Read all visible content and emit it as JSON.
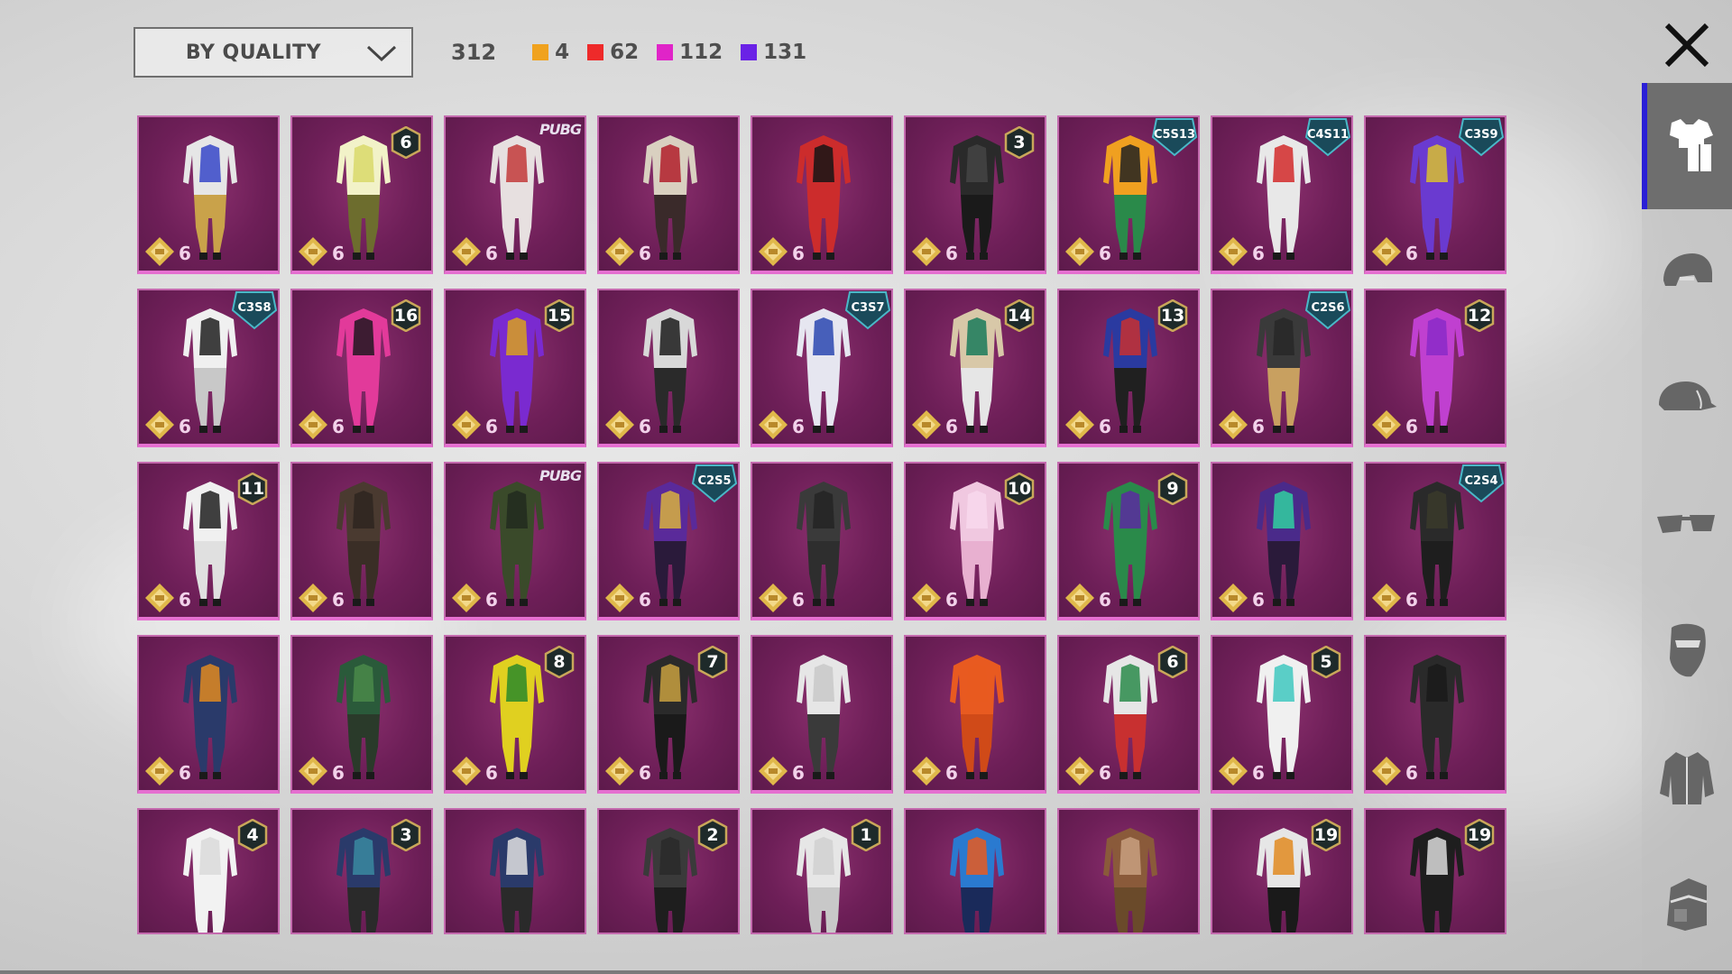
{
  "header": {
    "sort_label": "BY QUALITY",
    "total": "312",
    "quality_counts": [
      {
        "color": "#f0a21e",
        "count": "4"
      },
      {
        "color": "#ee2a2a",
        "count": "62"
      },
      {
        "color": "#e024c8",
        "count": "112"
      },
      {
        "color": "#6a22e6",
        "count": "131"
      }
    ]
  },
  "sidebar": {
    "items": [
      {
        "icon": "outfit-icon",
        "active": true
      },
      {
        "icon": "helmet-icon",
        "active": false
      },
      {
        "icon": "cap-icon",
        "active": false
      },
      {
        "icon": "glasses-icon",
        "active": false
      },
      {
        "icon": "mask-icon",
        "active": false
      },
      {
        "icon": "jacket-icon",
        "active": false
      },
      {
        "icon": "backpack-icon",
        "active": false
      }
    ]
  },
  "items": [
    {
      "qty": "6",
      "badge": "",
      "badge_type": "",
      "colors": [
        "#e6e6e6",
        "#3646c8",
        "#c9a24a"
      ]
    },
    {
      "qty": "6",
      "badge": "6",
      "badge_type": "num",
      "colors": [
        "#f2f2c8",
        "#d9d96a",
        "#6d6d2e"
      ]
    },
    {
      "qty": "6",
      "badge": "PUBG",
      "badge_type": "logo",
      "colors": [
        "#e7e0e0",
        "#c23a3a",
        "#e7e0e0"
      ]
    },
    {
      "qty": "6",
      "badge": "",
      "badge_type": "",
      "colors": [
        "#d9d0c0",
        "#b01e2a",
        "#3a2a2a"
      ]
    },
    {
      "qty": "6",
      "badge": "",
      "badge_type": "",
      "colors": [
        "#cc2c2c",
        "#151515",
        "#cc2c2c"
      ]
    },
    {
      "qty": "6",
      "badge": "3",
      "badge_type": "num",
      "colors": [
        "#2a2a2a",
        "#444444",
        "#1a1a1a"
      ]
    },
    {
      "qty": "6",
      "badge": "C5S13",
      "badge_type": "season",
      "colors": [
        "#f0a020",
        "#222222",
        "#2a8a4a"
      ]
    },
    {
      "qty": "6",
      "badge": "C4S11",
      "badge_type": "season",
      "colors": [
        "#e8e8e8",
        "#d22a2a",
        "#e8e8e8"
      ]
    },
    {
      "qty": "6",
      "badge": "C3S9",
      "badge_type": "season",
      "colors": [
        "#6a3ad0",
        "#d8c030",
        "#6a3ad0"
      ]
    },
    {
      "qty": "6",
      "badge": "C3S8",
      "badge_type": "season",
      "colors": [
        "#f0f0f0",
        "#202020",
        "#c8c8c8"
      ]
    },
    {
      "qty": "6",
      "badge": "16",
      "badge_type": "num",
      "colors": [
        "#e23a9a",
        "#201820",
        "#e23a9a"
      ]
    },
    {
      "qty": "6",
      "badge": "15",
      "badge_type": "num",
      "colors": [
        "#7a2ad0",
        "#d8a020",
        "#7a2ad0"
      ]
    },
    {
      "qty": "6",
      "badge": "",
      "badge_type": "",
      "colors": [
        "#d8d8d8",
        "#1c1c1c",
        "#2a2a2a"
      ]
    },
    {
      "qty": "6",
      "badge": "C3S7",
      "badge_type": "season",
      "colors": [
        "#e6e6f0",
        "#2a46b0",
        "#e6e6f0"
      ]
    },
    {
      "qty": "6",
      "badge": "14",
      "badge_type": "num",
      "colors": [
        "#d8c8a8",
        "#1a7a5a",
        "#e6e6e6"
      ]
    },
    {
      "qty": "6",
      "badge": "13",
      "badge_type": "num",
      "colors": [
        "#2a3aa0",
        "#c83030",
        "#202020"
      ]
    },
    {
      "qty": "6",
      "badge": "C2S6",
      "badge_type": "season",
      "colors": [
        "#3a3a3a",
        "#282828",
        "#c8a060"
      ]
    },
    {
      "qty": "6",
      "badge": "12",
      "badge_type": "num",
      "colors": [
        "#c040d0",
        "#8a2ac8",
        "#c040d0"
      ]
    },
    {
      "qty": "6",
      "badge": "11",
      "badge_type": "num",
      "colors": [
        "#f0f0f0",
        "#202020",
        "#e0e0e0"
      ]
    },
    {
      "qty": "6",
      "badge": "",
      "badge_type": "",
      "colors": [
        "#4a3a30",
        "#2e2620",
        "#3a2e26"
      ]
    },
    {
      "qty": "6",
      "badge": "PUBG",
      "badge_type": "logo",
      "colors": [
        "#3a4a2a",
        "#222a1e",
        "#3a4a2a"
      ]
    },
    {
      "qty": "6",
      "badge": "C2S5",
      "badge_type": "season",
      "colors": [
        "#5a2a9a",
        "#d8b040",
        "#2a1a3a"
      ]
    },
    {
      "qty": "6",
      "badge": "",
      "badge_type": "",
      "colors": [
        "#3a3a3a",
        "#242424",
        "#2e2e2e"
      ]
    },
    {
      "qty": "6",
      "badge": "10",
      "badge_type": "num",
      "colors": [
        "#f0c8e0",
        "#f8d8ec",
        "#e8b0d0"
      ]
    },
    {
      "qty": "6",
      "badge": "9",
      "badge_type": "num",
      "colors": [
        "#2a8a4a",
        "#5a2aa0",
        "#2a8a4a"
      ]
    },
    {
      "qty": "6",
      "badge": "",
      "badge_type": "",
      "colors": [
        "#4a2a8a",
        "#30d0a0",
        "#2a1a3a"
      ]
    },
    {
      "qty": "6",
      "badge": "C2S4",
      "badge_type": "season",
      "colors": [
        "#2a2a2a",
        "#3a3a2a",
        "#1e1e1e"
      ]
    },
    {
      "qty": "6",
      "badge": "",
      "badge_type": "",
      "colors": [
        "#2a3a6a",
        "#e08a20",
        "#2a3a6a"
      ]
    },
    {
      "qty": "6",
      "badge": "",
      "badge_type": "",
      "colors": [
        "#2a5a3a",
        "#4a8a4a",
        "#2a3a2a"
      ]
    },
    {
      "qty": "6",
      "badge": "8",
      "badge_type": "num",
      "colors": [
        "#e0d020",
        "#2a8a2a",
        "#e0d020"
      ]
    },
    {
      "qty": "6",
      "badge": "7",
      "badge_type": "num",
      "colors": [
        "#2a2a2a",
        "#c8a040",
        "#1a1a1a"
      ]
    },
    {
      "qty": "6",
      "badge": "",
      "badge_type": "",
      "colors": [
        "#e6e6e6",
        "#c8c8c8",
        "#3a3a3a"
      ]
    },
    {
      "qty": "6",
      "badge": "",
      "badge_type": "",
      "colors": [
        "#e85a20",
        "#e85a20",
        "#d04a18"
      ]
    },
    {
      "qty": "6",
      "badge": "6",
      "badge_type": "num",
      "colors": [
        "#e6e6e6",
        "#2a8a4a",
        "#c83030"
      ]
    },
    {
      "qty": "6",
      "badge": "5",
      "badge_type": "num",
      "colors": [
        "#f0f0f0",
        "#40c8c0",
        "#f0f0f0"
      ]
    },
    {
      "qty": "6",
      "badge": "",
      "badge_type": "",
      "colors": [
        "#2a2a2a",
        "#1a1a1a",
        "#2a2a2a"
      ]
    },
    {
      "qty": "",
      "badge": "4",
      "badge_type": "num",
      "colors": [
        "#f2f2f2",
        "#dadada",
        "#f2f2f2"
      ]
    },
    {
      "qty": "",
      "badge": "3",
      "badge_type": "num",
      "colors": [
        "#2a3a6a",
        "#3a8aa0",
        "#2a2a2a"
      ]
    },
    {
      "qty": "",
      "badge": "",
      "badge_type": "",
      "colors": [
        "#2a3a6a",
        "#e0e0e0",
        "#2a2a2a"
      ]
    },
    {
      "qty": "",
      "badge": "2",
      "badge_type": "num",
      "colors": [
        "#3a3a3a",
        "#2a2a2a",
        "#1e1e1e"
      ]
    },
    {
      "qty": "",
      "badge": "1",
      "badge_type": "num",
      "colors": [
        "#e6e6e6",
        "#d0d0d0",
        "#c8c8c8"
      ]
    },
    {
      "qty": "",
      "badge": "",
      "badge_type": "",
      "colors": [
        "#2a7ad0",
        "#e85a20",
        "#1a2a5a"
      ]
    },
    {
      "qty": "",
      "badge": "",
      "badge_type": "",
      "colors": [
        "#8a5a3a",
        "#c8a080",
        "#6a4a2a"
      ]
    },
    {
      "qty": "",
      "badge": "19",
      "badge_type": "num",
      "colors": [
        "#e6e6e6",
        "#e08a20",
        "#1a1a1a"
      ]
    },
    {
      "qty": "",
      "badge": "19",
      "badge_type": "num",
      "colors": [
        "#1e1e1e",
        "#dadada",
        "#1e1e1e"
      ]
    }
  ]
}
